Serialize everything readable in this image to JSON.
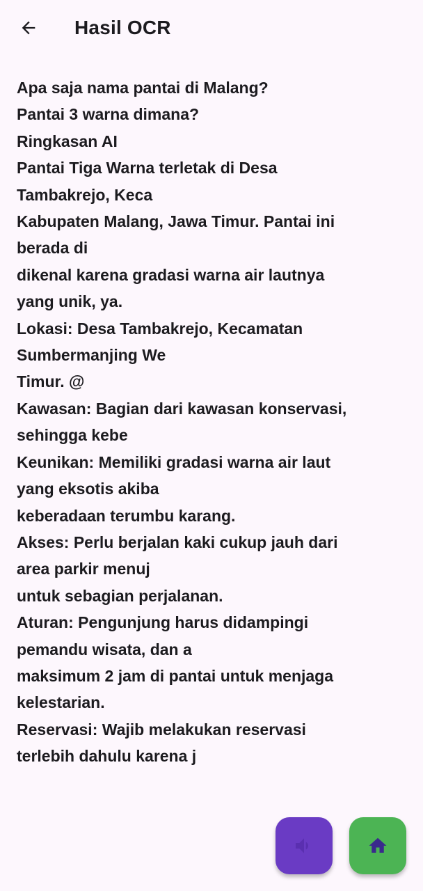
{
  "header": {
    "title": "Hasil OCR",
    "back_icon": "arrow-back-icon"
  },
  "ocr_text": {
    "lines": [
      "Apa saja nama pantai di Malang?",
      "Pantai 3 warna dimana?",
      "Ringkasan AI",
      "Pantai Tiga Warna terletak di Desa",
      "Tambakrejo, Keca",
      "Kabupaten Malang, Jawa Timur. Pantai ini",
      "berada di",
      "dikenal karena gradasi warna air lautnya",
      "yang unik, ya.",
      "Lokasi: Desa Tambakrejo, Kecamatan",
      "Sumbermanjing We",
      "Timur. @",
      "Kawasan: Bagian dari kawasan konservasi,",
      "sehingga kebe",
      "Keunikan: Memiliki gradasi warna air laut",
      "yang eksotis akiba",
      "keberadaan terumbu karang.",
      "Akses: Perlu berjalan kaki cukup jauh dari",
      "area parkir menuj",
      "untuk sebagian perjalanan.",
      "Aturan: Pengunjung harus didampingi",
      "pemandu wisata, dan a",
      "maksimum 2 jam di pantai untuk menjaga",
      "kelestarian.",
      "Reservasi: Wajib melakukan reservasi",
      "terlebih dahulu karena j"
    ]
  },
  "actions": {
    "speak_button": {
      "icon": "volume-icon",
      "background": "#6a3bc4",
      "icon_color": "#5a2fb0"
    },
    "home_button": {
      "icon": "home-icon",
      "background": "#4cb454",
      "icon_color": "#3a2a8c"
    }
  },
  "colors": {
    "background": "#fdf7fd",
    "text": "#1c1b1f"
  }
}
